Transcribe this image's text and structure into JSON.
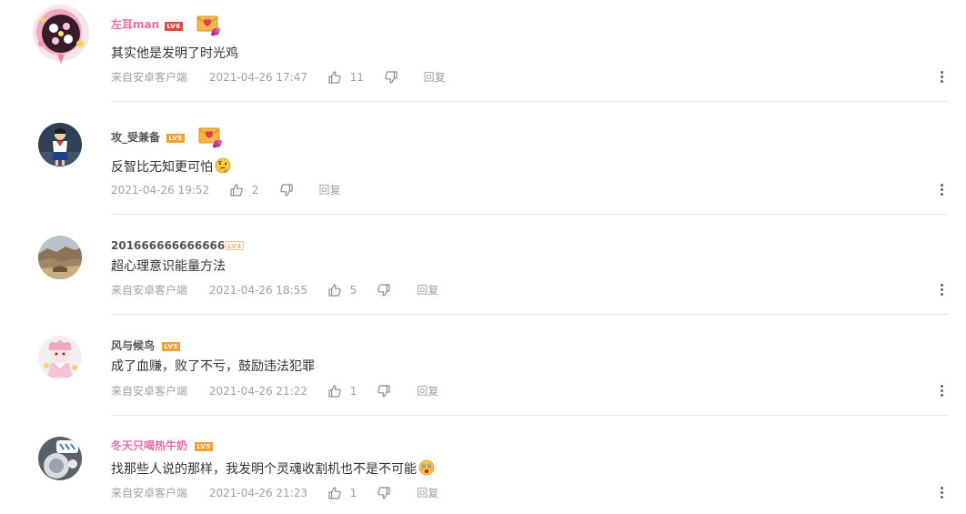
{
  "comments": [
    {
      "username": "左耳man",
      "level": "LV6",
      "text": "其实他是发明了时光鸡",
      "client": "来自安卓客户端",
      "time": "2021-04-26 17:47",
      "likes": "11",
      "reply": "回复"
    },
    {
      "username": "攻_受兼备",
      "level": "LV5",
      "text": "反智比无知更可怕",
      "client": "",
      "time": "2021-04-26 19:52",
      "likes": "2",
      "reply": "回复"
    },
    {
      "username": "2016666666666666",
      "level": "LV4",
      "text": "超心理意识能量方法",
      "client": "来自安卓客户端",
      "time": "2021-04-26 18:55",
      "likes": "5",
      "reply": "回复"
    },
    {
      "username": "风与候鸟",
      "level": "LV5",
      "text": "成了血赚，败了不亏，鼓励违法犯罪",
      "client": "来自安卓客户端",
      "time": "2021-04-26 21:22",
      "likes": "1",
      "reply": "回复"
    },
    {
      "username": "冬天只喝热牛奶",
      "level": "LV5",
      "text": "找那些人说的那样，我发明个灵魂收割机也不是不可能",
      "client": "来自安卓客户端",
      "time": "2021-04-26 21:23",
      "likes": "1",
      "reply": "回复"
    }
  ],
  "icons": {
    "like": "thumb-up-icon",
    "dislike": "thumb-down-icon",
    "more": "vertical-dots-icon",
    "medal": "love-letter-medal-icon",
    "emoji_thinking": "thinking-face-emoji",
    "emoji_shocked": "shocked-face-emoji"
  },
  "colors": {
    "username_vip": "#ea6fa0",
    "username_normal": "#555555",
    "meta": "#a0a0a0",
    "level_red": "#e3483e",
    "level_orange": "#f5a033"
  }
}
